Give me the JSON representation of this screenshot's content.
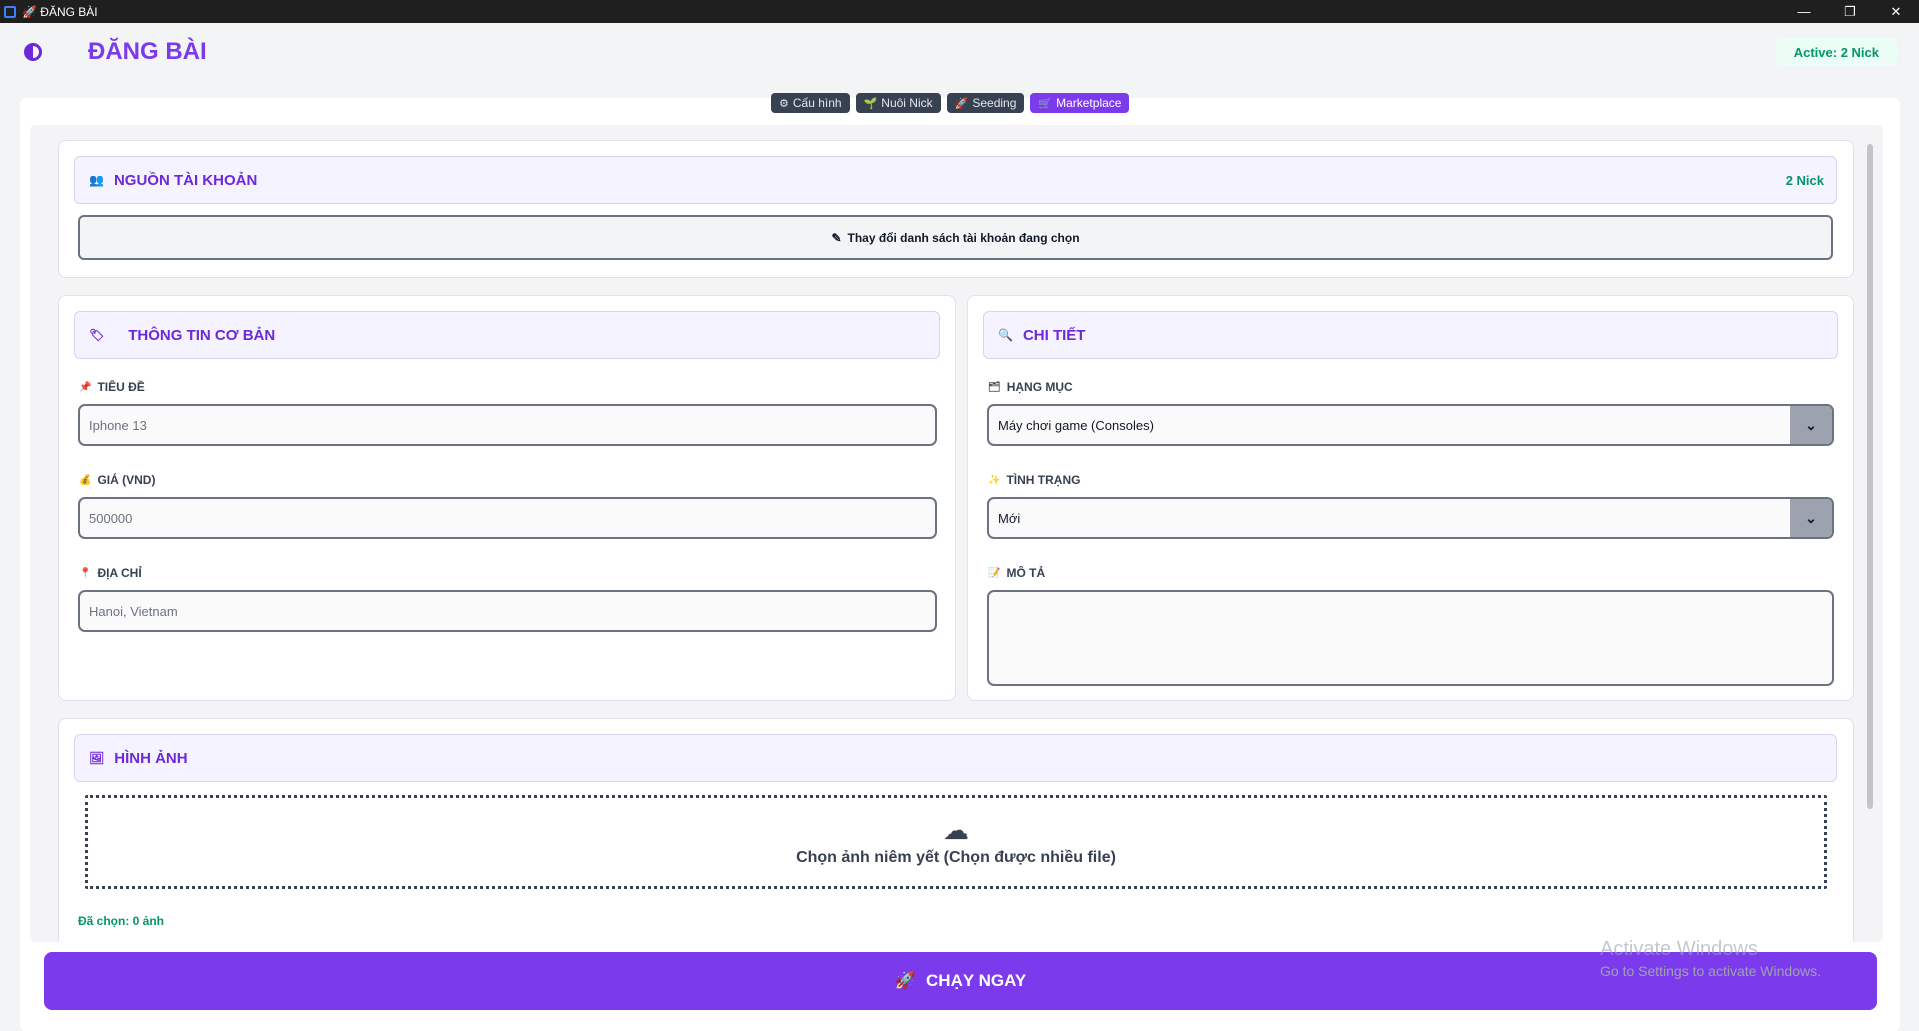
{
  "window": {
    "title": "🚀 ĐĂNG BÀI",
    "minimize": "—",
    "restore": "❐",
    "close": "✕"
  },
  "header": {
    "title": "ĐĂNG BÀI",
    "active_badge": "Active: 2 Nick"
  },
  "tabs": [
    {
      "icon": "⚙",
      "label": "Cấu hình"
    },
    {
      "icon": "🌱",
      "label": "Nuôi Nick"
    },
    {
      "icon": "🚀",
      "label": "Seeding"
    },
    {
      "icon": "🛒",
      "label": "Marketplace"
    }
  ],
  "account_source": {
    "icon": "👥",
    "title": "NGUỒN TÀI KHOẢN",
    "count": "2 Nick",
    "change_icon": "✎",
    "change_label": "Thay đổi danh sách tài khoản đang chọn"
  },
  "basic_info": {
    "icon": "🏷",
    "title": "THÔNG TIN CƠ BẢN",
    "title_field": {
      "icon": "📌",
      "label": "TIÊU ĐỀ",
      "placeholder": "Iphone 13"
    },
    "price_field": {
      "icon": "💰",
      "label": "GIÁ (VND)",
      "placeholder": "500000"
    },
    "address_field": {
      "icon": "📍",
      "label": "ĐỊA CHỈ",
      "placeholder": "Hanoi, Vietnam"
    }
  },
  "details": {
    "icon": "🔍",
    "title": "CHI TIẾT",
    "category": {
      "icon": "🗂",
      "label": "HẠNG MỤC",
      "value": "Máy chơi game (Consoles)"
    },
    "condition": {
      "icon": "✨",
      "label": "TÌNH TRẠNG",
      "value": "Mới"
    },
    "description": {
      "icon": "📝",
      "label": "MÔ TẢ",
      "value": ""
    }
  },
  "images": {
    "icon": "🖼",
    "title": "HÌNH ẢNH",
    "dropzone_icon": "☁",
    "dropzone_text": "Chọn ảnh niêm yết (Chọn được nhiều file)",
    "selected_text": "Đã chọn: 0 ảnh"
  },
  "run_button": {
    "icon": "🚀",
    "label": "CHẠY NGAY"
  },
  "watermark": {
    "line1": "Activate Windows",
    "line2": "Go to Settings to activate Windows."
  },
  "colors": {
    "accent": "#7c3aed",
    "success": "#059669",
    "titlebar": "#1f1f1f"
  }
}
